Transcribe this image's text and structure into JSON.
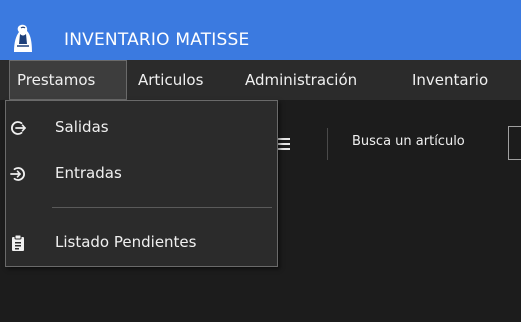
{
  "app": {
    "title": "INVENTARIO MATISSE"
  },
  "menubar": {
    "items": [
      {
        "label": "Prestamos"
      },
      {
        "label": "Articulos"
      },
      {
        "label": "Administración"
      },
      {
        "label": "Inventario"
      }
    ]
  },
  "dropdown": {
    "items": [
      {
        "label": "Salidas",
        "icon": "logout-arrow-icon"
      },
      {
        "label": "Entradas",
        "icon": "login-arrow-icon"
      },
      {
        "label": "Listado Pendientes",
        "icon": "clipboard-icon"
      }
    ]
  },
  "toolbar": {
    "search_label": "Busca un artículo",
    "search_value": ""
  },
  "colors": {
    "titlebar": "#3b7ae0",
    "menubar": "#2b2b2b",
    "background": "#1c1c1c",
    "text": "#f0f0f0"
  }
}
